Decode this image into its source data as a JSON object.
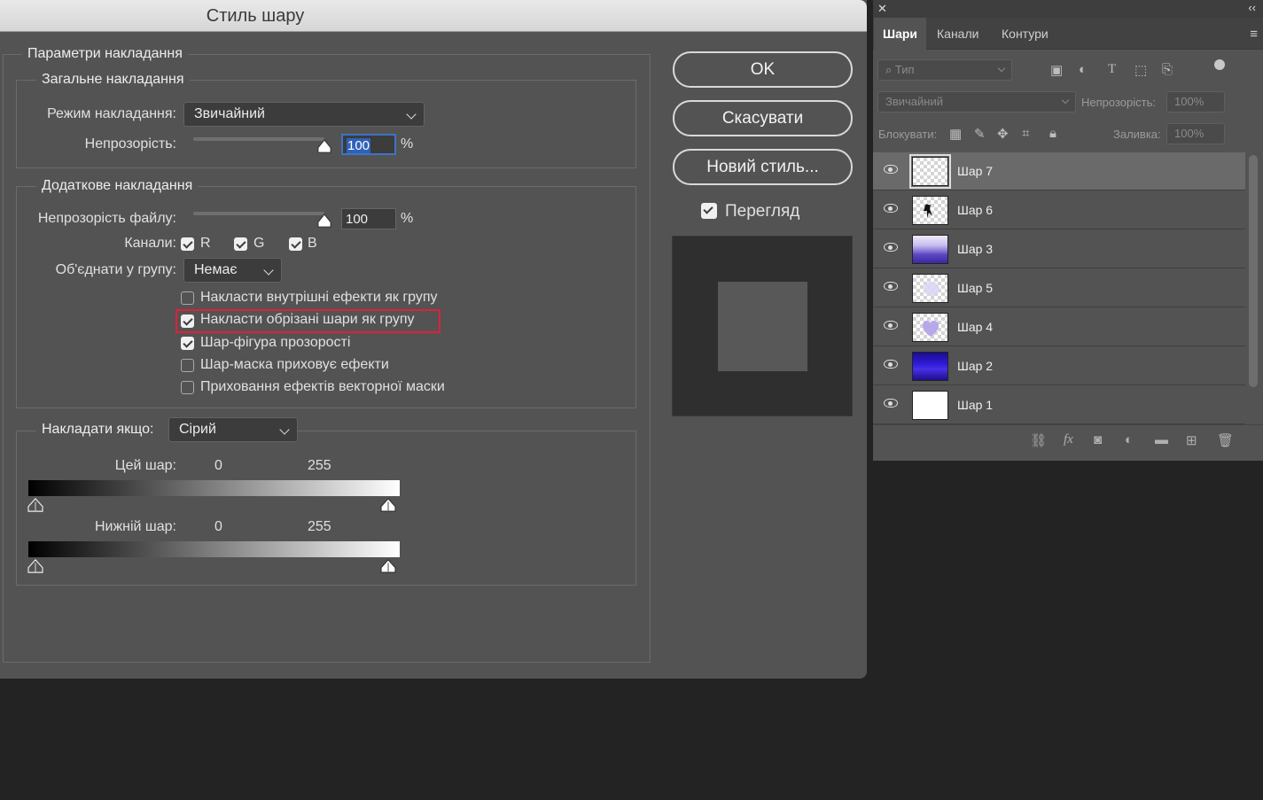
{
  "dialog": {
    "title": "Стиль шару",
    "blending_options": {
      "legend": "Параметри накладання",
      "general": {
        "legend": "Загальне накладання",
        "mode_label": "Режим накладання:",
        "mode_value": "Звичайний",
        "opacity_label": "Непрозорість:",
        "opacity_value": "100",
        "opacity_unit": "%",
        "opacity_level": 1.0
      },
      "advanced": {
        "legend": "Додаткове накладання",
        "fill_opacity_label": "Непрозорість файлу:",
        "fill_opacity_value": "100",
        "fill_opacity_unit": "%",
        "fill_opacity_level": 1.0,
        "channels_label": "Канали:",
        "channels": [
          {
            "label": "R",
            "checked": true
          },
          {
            "label": "G",
            "checked": true
          },
          {
            "label": "B",
            "checked": true
          }
        ],
        "knockout_label": "Об'єднати у групу:",
        "knockout_value": "Немає",
        "options": [
          {
            "label": "Накласти внутрішні ефекти як групу",
            "checked": false
          },
          {
            "label": "Накласти обрізані шари як групу",
            "checked": true,
            "highlighted": true
          },
          {
            "label": "Шар-фігура прозорості",
            "checked": true
          },
          {
            "label": "Шар-маска приховує ефекти",
            "checked": false
          },
          {
            "label": "Приховання ефектів векторної маски",
            "checked": false
          }
        ]
      },
      "blend_if": {
        "label": "Накладати якщо:",
        "value": "Сірий",
        "this_layer": {
          "label": "Цей шар:",
          "min": "0",
          "max": "255"
        },
        "underlying_layer": {
          "label": "Нижній шар:",
          "min": "0",
          "max": "255"
        }
      }
    },
    "buttons": {
      "ok": "OK",
      "cancel": "Скасувати",
      "new_style": "Новий стиль..."
    },
    "preview": {
      "label": "Перегляд",
      "checked": true
    }
  },
  "layers_panel": {
    "tabs": [
      "Шари",
      "Канали",
      "Контури"
    ],
    "active_tab": 0,
    "filter_placeholder": "Тип",
    "blend_mode": "Звичайний",
    "opacity_label": "Непрозорість:",
    "opacity_value": "100%",
    "lock_label": "Блокувати:",
    "fill_label": "Заливка:",
    "fill_value": "100%",
    "layers": [
      {
        "name": "Шар 7",
        "thumb": "transparent",
        "active": true
      },
      {
        "name": "Шар 6",
        "thumb": "figure"
      },
      {
        "name": "Шар 3",
        "thumb": "purple-wave"
      },
      {
        "name": "Шар 5",
        "thumb": "light-blob"
      },
      {
        "name": "Шар 4",
        "thumb": "heart"
      },
      {
        "name": "Шар 2",
        "thumb": "blue-night"
      },
      {
        "name": "Шар 1",
        "thumb": "white"
      }
    ]
  },
  "colors": {
    "highlight": "#e0203a",
    "selection": "#2f61b8",
    "dialog_bg": "#535353"
  }
}
